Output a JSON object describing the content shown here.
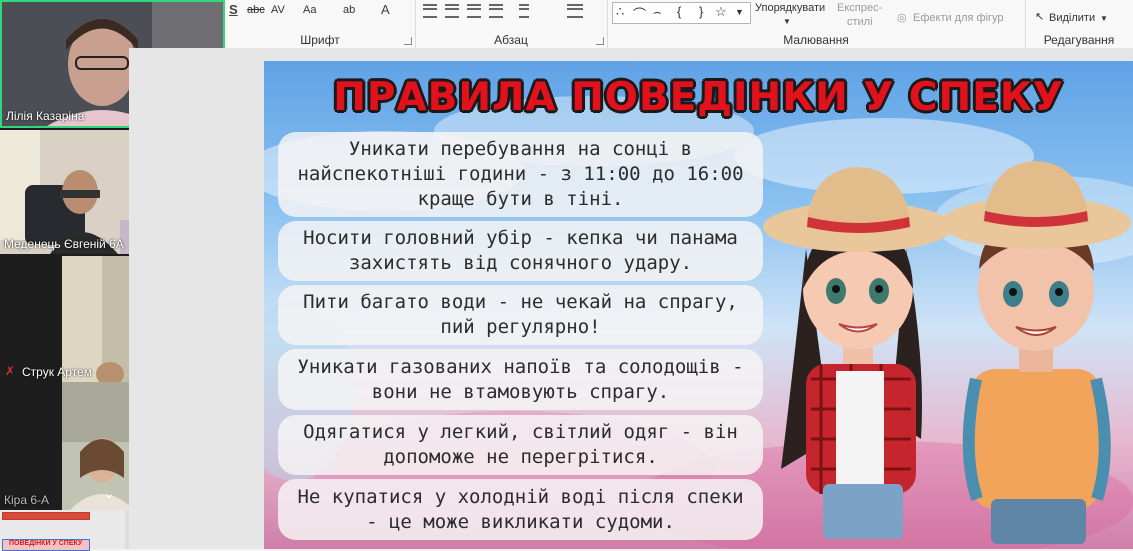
{
  "ribbon": {
    "font_group_label": "Шрифт",
    "paragraph_group_label": "Абзац",
    "drawing_group_label": "Малювання",
    "editing_group_label": "Редагування",
    "arrange_label": "Упорядкувати",
    "quick_styles_label_1": "Експрес-",
    "quick_styles_label_2": "стилі",
    "shape_effects_label": "Ефекти для фігур",
    "select_label": "Виділити",
    "bold_glyph": "S",
    "case_glyph": "Aa",
    "spacing_glyph": "AV",
    "strike_glyph": "abc",
    "highlight_glyph": "ab",
    "font_color_glyph": "A"
  },
  "participants": [
    {
      "name": "Лілія Казаріна"
    },
    {
      "name": "Меденець Євгеній 6А"
    },
    {
      "name": "Струк Артем"
    },
    {
      "name": "Кіра 6-А"
    }
  ],
  "thumbnails": {
    "current_label": "ПОВЕДІНКИ У СПЕКУ"
  },
  "slide": {
    "title": "ПРАВИЛА ПОВЕДІНКИ У СПЕКУ",
    "rules": [
      "Уникати перебування на сонці в найспекотніші години - з 11:00 до 16:00 краще бути в тіні.",
      "Носити головний убір - кепка чи панама захистять від сонячного удару.",
      "Пити багато води - не чекай на спрагу, пий регулярно!",
      "Уникати газованих напоїв та солодощів - вони не втамовують спрагу.",
      "Одягатися у легкий, світлий одяг - він допоможе не перегрітися.",
      "Не купатися у холодній воді після спеки - це може викликати судоми."
    ]
  },
  "colors": {
    "title_red": "#e2111b",
    "active_speaker_border": "#2fd87a",
    "thumb_red": "#d94a3a"
  }
}
